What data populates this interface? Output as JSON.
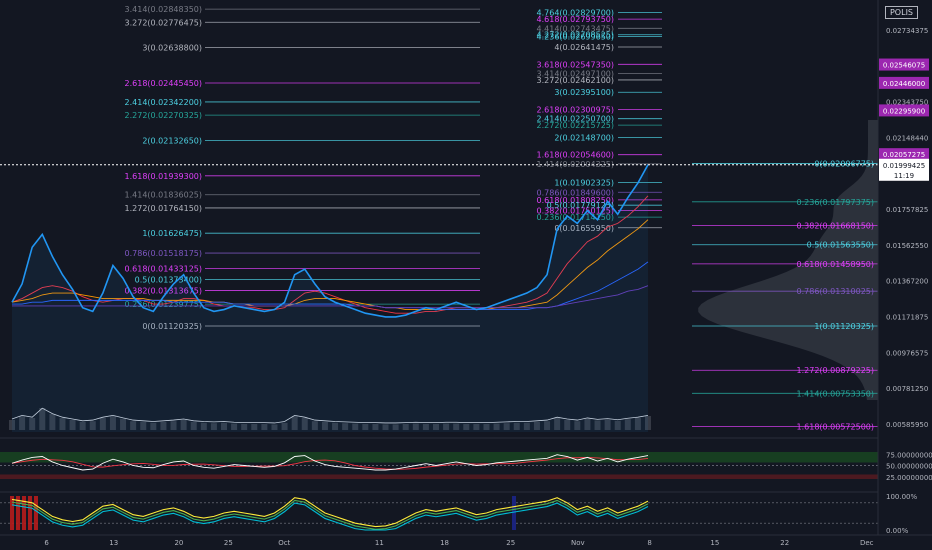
{
  "symbol": "POLIS",
  "price_axis": {
    "ticks": [
      "0.02734375",
      "0.02343750",
      "0.02148440",
      "0.01757825",
      "0.01562550",
      "0.01367200",
      "0.01171875",
      "0.00976575",
      "0.00781250",
      "0.00585950"
    ],
    "tick_values": [
      0.02734375,
      0.0234375,
      0.0214844,
      0.01757825,
      0.0156255,
      0.013672,
      0.01171875,
      0.00976575,
      0.0078125,
      0.0058595
    ],
    "current": {
      "price": "0.01999425",
      "countdown": "11:19",
      "value": 0.01999425
    },
    "badges": [
      {
        "text": "0.02546075",
        "value": 0.02546075
      },
      {
        "text": "0.02446000",
        "value": 0.02446
      },
      {
        "text": "0.02295900",
        "value": 0.022959
      },
      {
        "text": "0.02057275",
        "value": 0.02057275
      }
    ]
  },
  "time_axis": {
    "labels": [
      "6",
      "13",
      "20",
      "25",
      "Oct",
      "11",
      "18",
      "25",
      "Nov",
      "8",
      "15",
      "22",
      "Dec"
    ],
    "x_fraction": [
      0.05,
      0.122,
      0.192,
      0.245,
      0.305,
      0.407,
      0.477,
      0.548,
      0.62,
      0.697,
      0.767,
      0.842,
      0.93
    ]
  },
  "chart_data": [
    {
      "type": "line",
      "panel": "price",
      "series_price": [
        0.0125,
        0.0135,
        0.0155,
        0.0162,
        0.015,
        0.014,
        0.0132,
        0.0122,
        0.012,
        0.013,
        0.0145,
        0.0138,
        0.0128,
        0.0122,
        0.012,
        0.0128,
        0.0135,
        0.014,
        0.013,
        0.0122,
        0.012,
        0.0121,
        0.0123,
        0.0122,
        0.0121,
        0.012,
        0.0121,
        0.0125,
        0.014,
        0.0143,
        0.0135,
        0.0128,
        0.0125,
        0.0123,
        0.0121,
        0.0119,
        0.0118,
        0.0117,
        0.0117,
        0.0118,
        0.012,
        0.0122,
        0.0121,
        0.0123,
        0.0125,
        0.0123,
        0.0121,
        0.0122,
        0.0124,
        0.0126,
        0.0128,
        0.013,
        0.0133,
        0.014,
        0.0165,
        0.0172,
        0.0168,
        0.0175,
        0.017,
        0.018,
        0.0173,
        0.0182,
        0.019,
        0.02
      ],
      "moving_averages": [
        {
          "color": "#f23645",
          "values": [
            0.0125,
            0.0127,
            0.013,
            0.0133,
            0.0134,
            0.0133,
            0.0131,
            0.0128,
            0.0126,
            0.0125,
            0.0126,
            0.0127,
            0.0127,
            0.0126,
            0.0124,
            0.0124,
            0.0125,
            0.0127,
            0.0127,
            0.0126,
            0.0124,
            0.0123,
            0.0123,
            0.0122,
            0.0122,
            0.0121,
            0.0121,
            0.0122,
            0.0126,
            0.013,
            0.0131,
            0.013,
            0.0128,
            0.0126,
            0.0124,
            0.0122,
            0.0121,
            0.012,
            0.0119,
            0.0119,
            0.0119,
            0.012,
            0.012,
            0.0121,
            0.0122,
            0.0122,
            0.0122,
            0.0122,
            0.0122,
            0.0123,
            0.0124,
            0.0125,
            0.0127,
            0.013,
            0.0138,
            0.0146,
            0.0152,
            0.0158,
            0.0161,
            0.0166,
            0.0168,
            0.0172,
            0.0177,
            0.0183
          ]
        },
        {
          "color": "#ff9800",
          "values": [
            0.0125,
            0.0126,
            0.0127,
            0.0129,
            0.013,
            0.013,
            0.013,
            0.0129,
            0.0128,
            0.0127,
            0.0127,
            0.0127,
            0.0127,
            0.0127,
            0.0126,
            0.0126,
            0.0126,
            0.0126,
            0.0126,
            0.0126,
            0.0125,
            0.0125,
            0.0124,
            0.0124,
            0.0123,
            0.0123,
            0.0123,
            0.0123,
            0.0124,
            0.0126,
            0.0127,
            0.0127,
            0.0127,
            0.0126,
            0.0125,
            0.0124,
            0.0123,
            0.0122,
            0.0122,
            0.0121,
            0.0121,
            0.0121,
            0.0121,
            0.0121,
            0.0121,
            0.0121,
            0.0121,
            0.0121,
            0.0122,
            0.0122,
            0.0122,
            0.0123,
            0.0124,
            0.0125,
            0.0129,
            0.0134,
            0.0139,
            0.0144,
            0.0148,
            0.0153,
            0.0157,
            0.0161,
            0.0165,
            0.017
          ]
        },
        {
          "color": "#2962ff",
          "values": [
            0.0124,
            0.0124,
            0.0125,
            0.0125,
            0.0126,
            0.0126,
            0.0126,
            0.0126,
            0.0126,
            0.0126,
            0.0126,
            0.0126,
            0.0126,
            0.0126,
            0.0126,
            0.0126,
            0.0125,
            0.0125,
            0.0125,
            0.0125,
            0.0125,
            0.0125,
            0.0124,
            0.0124,
            0.0124,
            0.0124,
            0.0124,
            0.0124,
            0.0124,
            0.0124,
            0.0124,
            0.0124,
            0.0124,
            0.0124,
            0.0123,
            0.0123,
            0.0123,
            0.0122,
            0.0122,
            0.0122,
            0.0122,
            0.0122,
            0.0121,
            0.0121,
            0.0121,
            0.0121,
            0.0121,
            0.0121,
            0.0121,
            0.0121,
            0.0121,
            0.0121,
            0.0122,
            0.0122,
            0.0123,
            0.0125,
            0.0127,
            0.0129,
            0.0131,
            0.0134,
            0.0137,
            0.014,
            0.0143,
            0.0147
          ]
        },
        {
          "color": "#673ab7",
          "values": [
            0.0123,
            0.0123,
            0.0123,
            0.0123,
            0.0123,
            0.0123,
            0.0123,
            0.0123,
            0.0123,
            0.0123,
            0.0123,
            0.0123,
            0.0123,
            0.0123,
            0.0123,
            0.0123,
            0.0123,
            0.0123,
            0.0123,
            0.0123,
            0.0123,
            0.0123,
            0.0123,
            0.0123,
            0.0123,
            0.0123,
            0.0123,
            0.0123,
            0.0123,
            0.0123,
            0.0123,
            0.0123,
            0.0123,
            0.0123,
            0.0123,
            0.0123,
            0.0123,
            0.0122,
            0.0122,
            0.0122,
            0.0122,
            0.0122,
            0.0122,
            0.0122,
            0.0122,
            0.0122,
            0.0122,
            0.0122,
            0.0122,
            0.0122,
            0.0122,
            0.0122,
            0.0122,
            0.0122,
            0.0123,
            0.0124,
            0.0125,
            0.0126,
            0.0127,
            0.0128,
            0.0129,
            0.0131,
            0.0132,
            0.0134
          ]
        }
      ],
      "volume": [
        0.25,
        0.35,
        0.3,
        0.55,
        0.4,
        0.3,
        0.25,
        0.2,
        0.22,
        0.3,
        0.35,
        0.28,
        0.22,
        0.2,
        0.18,
        0.2,
        0.22,
        0.25,
        0.2,
        0.18,
        0.17,
        0.18,
        0.16,
        0.15,
        0.15,
        0.15,
        0.14,
        0.18,
        0.35,
        0.3,
        0.22,
        0.2,
        0.18,
        0.17,
        0.16,
        0.15,
        0.15,
        0.14,
        0.14,
        0.15,
        0.16,
        0.15,
        0.15,
        0.16,
        0.16,
        0.15,
        0.15,
        0.15,
        0.16,
        0.17,
        0.18,
        0.18,
        0.2,
        0.22,
        0.3,
        0.25,
        0.22,
        0.28,
        0.24,
        0.26,
        0.23,
        0.27,
        0.3,
        0.35
      ]
    },
    {
      "type": "line",
      "panel": "rsi",
      "yticks": [
        "75.00000000",
        "50.00000000",
        "25.00000000"
      ],
      "ytick_values": [
        75,
        50,
        25
      ],
      "values": [
        55,
        62,
        68,
        70,
        58,
        50,
        45,
        40,
        42,
        55,
        64,
        58,
        50,
        46,
        45,
        52,
        58,
        60,
        50,
        46,
        44,
        48,
        52,
        50,
        48,
        46,
        48,
        56,
        70,
        72,
        60,
        52,
        48,
        46,
        44,
        42,
        40,
        40,
        42,
        46,
        50,
        54,
        50,
        54,
        58,
        54,
        50,
        52,
        56,
        58,
        60,
        62,
        64,
        66,
        74,
        70,
        62,
        68,
        60,
        66,
        58,
        64,
        68,
        72
      ]
    },
    {
      "type": "line",
      "panel": "stoch",
      "yticks": [
        "100.00%",
        "0.00%"
      ],
      "ytick_values": [
        100,
        0
      ],
      "values": [
        90,
        85,
        80,
        60,
        40,
        30,
        25,
        30,
        50,
        70,
        75,
        60,
        45,
        40,
        50,
        60,
        65,
        55,
        40,
        35,
        40,
        50,
        55,
        50,
        45,
        40,
        50,
        70,
        95,
        90,
        70,
        50,
        40,
        30,
        20,
        15,
        10,
        12,
        20,
        35,
        50,
        60,
        55,
        60,
        65,
        55,
        45,
        50,
        60,
        65,
        70,
        75,
        80,
        85,
        95,
        80,
        60,
        70,
        55,
        65,
        50,
        60,
        70,
        85
      ]
    }
  ],
  "fibs": {
    "left": [
      {
        "label": "3.414(0.02848350)",
        "color": "#787b86",
        "value": 0.0284835
      },
      {
        "label": "3.272(0.02776475)",
        "color": "#b2b5be",
        "value": 0.02776475
      },
      {
        "label": "3(0.02638800)",
        "color": "#b2b5be",
        "value": 0.026388
      },
      {
        "label": "2.618(0.02445450)",
        "color": "#e040fb",
        "value": 0.0244545
      },
      {
        "label": "2.414(0.02342200)",
        "color": "#4dd0e1",
        "value": 0.023422
      },
      {
        "label": "2.272(0.02270325)",
        "color": "#26a69a",
        "value": 0.02270325
      },
      {
        "label": "2(0.02132650)",
        "color": "#4dd0e1",
        "value": 0.0213265
      },
      {
        "label": "1.618(0.01939300)",
        "color": "#e040fb",
        "value": 0.019393
      },
      {
        "label": "1.414(0.01836025)",
        "color": "#787b86",
        "value": 0.01836025
      },
      {
        "label": "1.272(0.01764150)",
        "color": "#b2b5be",
        "value": 0.0176415
      },
      {
        "label": "1(0.01626475)",
        "color": "#4dd0e1",
        "value": 0.01626475
      },
      {
        "label": "0.786(0.01518175)",
        "color": "#7e57c2",
        "value": 0.01518175
      },
      {
        "label": "0.618(0.01433125)",
        "color": "#e040fb",
        "value": 0.01433125
      },
      {
        "label": "0.5(0.01373400)",
        "color": "#4dd0e1",
        "value": 0.013734
      },
      {
        "label": "0.382(0.01313675)",
        "color": "#e040fb",
        "value": 0.01313675
      },
      {
        "label": "0.236(0.01239775)",
        "color": "#26a69a",
        "value": 0.01239775
      },
      {
        "label": "0(0.01120325)",
        "color": "#b2b5be",
        "value": 0.01120325
      }
    ],
    "mid": [
      {
        "label": "4.764(0.02829700)",
        "color": "#4dd0e1",
        "value": 0.028297
      },
      {
        "label": "4.618(0.02793750)",
        "color": "#e040fb",
        "value": 0.0279375
      },
      {
        "label": "4.414(0.02743475)",
        "color": "#787b86",
        "value": 0.02743475
      },
      {
        "label": "4.272(0.02708525)",
        "color": "#4dd0e1",
        "value": 0.02708525
      },
      {
        "label": "4.236(0.02699650)",
        "color": "#4dd0e1",
        "value": 0.0269965
      },
      {
        "label": "4(0.02641475)",
        "color": "#b2b5be",
        "value": 0.02641475
      },
      {
        "label": "3.618(0.02547350)",
        "color": "#e040fb",
        "value": 0.0254735
      },
      {
        "label": "3.414(0.02497100)",
        "color": "#787b86",
        "value": 0.024971
      },
      {
        "label": "3.272(0.02462100)",
        "color": "#b2b5be",
        "value": 0.024621
      },
      {
        "label": "3(0.02395100)",
        "color": "#4dd0e1",
        "value": 0.023951
      },
      {
        "label": "2.618(0.02300975)",
        "color": "#e040fb",
        "value": 0.02300975
      },
      {
        "label": "2.414(0.02250700)",
        "color": "#4dd0e1",
        "value": 0.022507
      },
      {
        "label": "2.272(0.02215725)",
        "color": "#26a69a",
        "value": 0.02215725
      },
      {
        "label": "2(0.02148700)",
        "color": "#4dd0e1",
        "value": 0.021487
      },
      {
        "label": "1.618(0.02054600)",
        "color": "#e040fb",
        "value": 0.020546
      },
      {
        "label": "1.414(0.02004325)",
        "color": "#787b86",
        "value": 0.02004325
      },
      {
        "label": "1(0.01902325)",
        "color": "#4dd0e1",
        "value": 0.01902325
      },
      {
        "label": "0.786(0.01849600)",
        "color": "#7e57c2",
        "value": 0.018496
      },
      {
        "label": "0.618(0.01808250)",
        "color": "#e040fb",
        "value": 0.0180825
      },
      {
        "label": "0.5(0.01779125)",
        "color": "#4dd0e1",
        "value": 0.01779125
      },
      {
        "label": "0.382(0.01750125)",
        "color": "#e040fb",
        "value": 0.01750125
      },
      {
        "label": "0.236(0.01714150)",
        "color": "#26a69a",
        "value": 0.0171415
      },
      {
        "label": "0(0.01655950)",
        "color": "#b2b5be",
        "value": 0.0165595
      }
    ],
    "right": [
      {
        "label": "0(0.02006775)",
        "color": "#4dd0e1",
        "value": 0.02006775
      },
      {
        "label": "0.236(0.01797375)",
        "color": "#26a69a",
        "value": 0.01797375
      },
      {
        "label": "0.382(0.01668150)",
        "color": "#e040fb",
        "value": 0.0166815
      },
      {
        "label": "0.5(0.01563550)",
        "color": "#4dd0e1",
        "value": 0.0156355
      },
      {
        "label": "0.618(0.01458950)",
        "color": "#e040fb",
        "value": 0.0145895
      },
      {
        "label": "0.786(0.01310025)",
        "color": "#7e57c2",
        "value": 0.01310025
      },
      {
        "label": "1(0.01120325)",
        "color": "#4dd0e1",
        "value": 0.01120325
      },
      {
        "label": "1.272(0.00879225)",
        "color": "#e040fb",
        "value": 0.00879225
      },
      {
        "label": "1.414(0.00753350)",
        "color": "#26a69a",
        "value": 0.0075335
      },
      {
        "label": "1.618(0.00572500)",
        "color": "#e040fb",
        "value": 0.005725
      }
    ]
  },
  "colors": {
    "background": "#131722",
    "price_line": "#2196f3",
    "rsi_line": "#ffffff",
    "rsi_ma": "#f23645",
    "badge_bg": "#9c27b0",
    "current_line": "#ffffff"
  }
}
